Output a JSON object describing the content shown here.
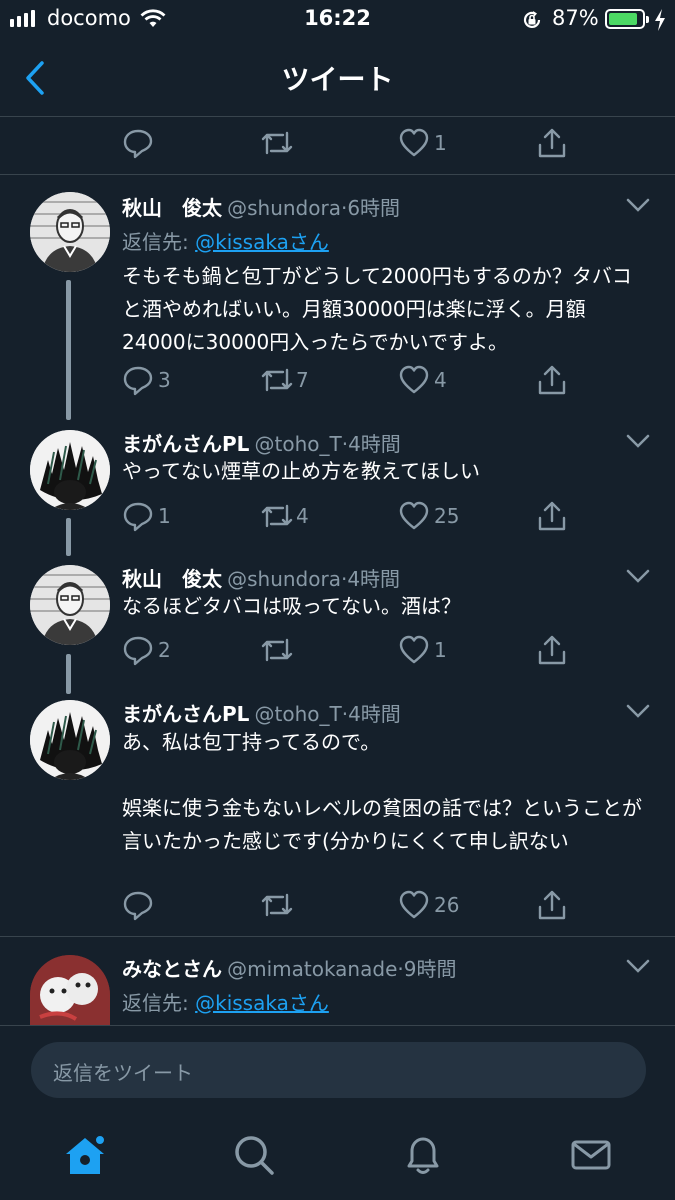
{
  "status_bar": {
    "carrier": "docomo",
    "time": "16:22",
    "battery_percent": "87%",
    "battery_level": 0.87
  },
  "nav": {
    "title": "ツイート",
    "back_icon": "chevron-left-icon"
  },
  "top_actions": {
    "reply_count": "",
    "retweet_count": "",
    "like_count": "1"
  },
  "tweets": [
    {
      "name": "秋山　俊太",
      "handle": "@shundora",
      "time": "6時間",
      "reply_to_label": "返信先: ",
      "reply_to_mention": "@kissakaさん",
      "text": "そもそも鍋と包丁がどうして2000円もするのか？タバコと酒やめればいい。月額30000円は楽に浮く。月額24000に30000円入ったらでかいですよ。",
      "replies": "3",
      "retweets": "7",
      "likes": "4"
    },
    {
      "name": "まがんさんPL",
      "handle": "@toho_T",
      "time": "4時間",
      "text": "やってない煙草の止め方を教えてほしい",
      "replies": "1",
      "retweets": "4",
      "likes": "25"
    },
    {
      "name": "秋山　俊太",
      "handle": "@shundora",
      "time": "4時間",
      "text": "なるほどタバコは吸ってない。酒は？",
      "replies": "2",
      "retweets": "",
      "likes": "1"
    },
    {
      "name": "まがんさんPL",
      "handle": "@toho_T",
      "time": "4時間",
      "text": "あ、私は包丁持ってるので。\n\n娯楽に使う金もないレベルの貧困の話では？ということが言いたかった感じです(分かりにくくて申し訳ない",
      "replies": "",
      "retweets": "",
      "likes": "26"
    },
    {
      "name": "みなとさん",
      "handle": "@mimatokanade",
      "time": "9時間",
      "reply_to_label": "返信先: ",
      "reply_to_mention": "@kissakaさん"
    }
  ],
  "separator": "·",
  "reply_bar": {
    "placeholder": "返信をツイート"
  },
  "tab_bar": {
    "items": [
      "home-icon",
      "search-icon",
      "notifications-icon",
      "messages-icon"
    ],
    "active_color": "#1da1f2"
  },
  "colors": {
    "background": "#15202b",
    "accent": "#1da1f2",
    "muted": "#8899a6",
    "battery": "#4cd964"
  }
}
